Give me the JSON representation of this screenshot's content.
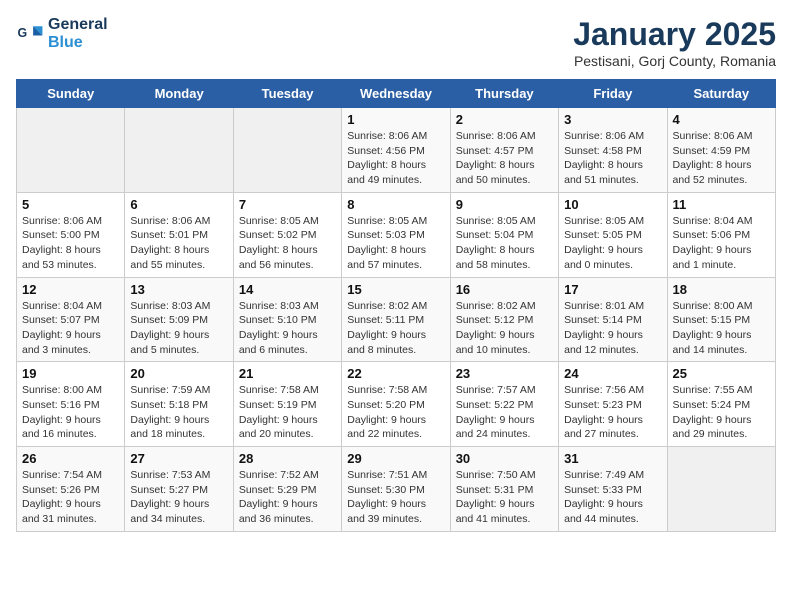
{
  "header": {
    "logo_line1": "General",
    "logo_line2": "Blue",
    "month": "January 2025",
    "location": "Pestisani, Gorj County, Romania"
  },
  "weekdays": [
    "Sunday",
    "Monday",
    "Tuesday",
    "Wednesday",
    "Thursday",
    "Friday",
    "Saturday"
  ],
  "weeks": [
    [
      {
        "day": "",
        "detail": ""
      },
      {
        "day": "",
        "detail": ""
      },
      {
        "day": "",
        "detail": ""
      },
      {
        "day": "1",
        "detail": "Sunrise: 8:06 AM\nSunset: 4:56 PM\nDaylight: 8 hours\nand 49 minutes."
      },
      {
        "day": "2",
        "detail": "Sunrise: 8:06 AM\nSunset: 4:57 PM\nDaylight: 8 hours\nand 50 minutes."
      },
      {
        "day": "3",
        "detail": "Sunrise: 8:06 AM\nSunset: 4:58 PM\nDaylight: 8 hours\nand 51 minutes."
      },
      {
        "day": "4",
        "detail": "Sunrise: 8:06 AM\nSunset: 4:59 PM\nDaylight: 8 hours\nand 52 minutes."
      }
    ],
    [
      {
        "day": "5",
        "detail": "Sunrise: 8:06 AM\nSunset: 5:00 PM\nDaylight: 8 hours\nand 53 minutes."
      },
      {
        "day": "6",
        "detail": "Sunrise: 8:06 AM\nSunset: 5:01 PM\nDaylight: 8 hours\nand 55 minutes."
      },
      {
        "day": "7",
        "detail": "Sunrise: 8:05 AM\nSunset: 5:02 PM\nDaylight: 8 hours\nand 56 minutes."
      },
      {
        "day": "8",
        "detail": "Sunrise: 8:05 AM\nSunset: 5:03 PM\nDaylight: 8 hours\nand 57 minutes."
      },
      {
        "day": "9",
        "detail": "Sunrise: 8:05 AM\nSunset: 5:04 PM\nDaylight: 8 hours\nand 58 minutes."
      },
      {
        "day": "10",
        "detail": "Sunrise: 8:05 AM\nSunset: 5:05 PM\nDaylight: 9 hours\nand 0 minutes."
      },
      {
        "day": "11",
        "detail": "Sunrise: 8:04 AM\nSunset: 5:06 PM\nDaylight: 9 hours\nand 1 minute."
      }
    ],
    [
      {
        "day": "12",
        "detail": "Sunrise: 8:04 AM\nSunset: 5:07 PM\nDaylight: 9 hours\nand 3 minutes."
      },
      {
        "day": "13",
        "detail": "Sunrise: 8:03 AM\nSunset: 5:09 PM\nDaylight: 9 hours\nand 5 minutes."
      },
      {
        "day": "14",
        "detail": "Sunrise: 8:03 AM\nSunset: 5:10 PM\nDaylight: 9 hours\nand 6 minutes."
      },
      {
        "day": "15",
        "detail": "Sunrise: 8:02 AM\nSunset: 5:11 PM\nDaylight: 9 hours\nand 8 minutes."
      },
      {
        "day": "16",
        "detail": "Sunrise: 8:02 AM\nSunset: 5:12 PM\nDaylight: 9 hours\nand 10 minutes."
      },
      {
        "day": "17",
        "detail": "Sunrise: 8:01 AM\nSunset: 5:14 PM\nDaylight: 9 hours\nand 12 minutes."
      },
      {
        "day": "18",
        "detail": "Sunrise: 8:00 AM\nSunset: 5:15 PM\nDaylight: 9 hours\nand 14 minutes."
      }
    ],
    [
      {
        "day": "19",
        "detail": "Sunrise: 8:00 AM\nSunset: 5:16 PM\nDaylight: 9 hours\nand 16 minutes."
      },
      {
        "day": "20",
        "detail": "Sunrise: 7:59 AM\nSunset: 5:18 PM\nDaylight: 9 hours\nand 18 minutes."
      },
      {
        "day": "21",
        "detail": "Sunrise: 7:58 AM\nSunset: 5:19 PM\nDaylight: 9 hours\nand 20 minutes."
      },
      {
        "day": "22",
        "detail": "Sunrise: 7:58 AM\nSunset: 5:20 PM\nDaylight: 9 hours\nand 22 minutes."
      },
      {
        "day": "23",
        "detail": "Sunrise: 7:57 AM\nSunset: 5:22 PM\nDaylight: 9 hours\nand 24 minutes."
      },
      {
        "day": "24",
        "detail": "Sunrise: 7:56 AM\nSunset: 5:23 PM\nDaylight: 9 hours\nand 27 minutes."
      },
      {
        "day": "25",
        "detail": "Sunrise: 7:55 AM\nSunset: 5:24 PM\nDaylight: 9 hours\nand 29 minutes."
      }
    ],
    [
      {
        "day": "26",
        "detail": "Sunrise: 7:54 AM\nSunset: 5:26 PM\nDaylight: 9 hours\nand 31 minutes."
      },
      {
        "day": "27",
        "detail": "Sunrise: 7:53 AM\nSunset: 5:27 PM\nDaylight: 9 hours\nand 34 minutes."
      },
      {
        "day": "28",
        "detail": "Sunrise: 7:52 AM\nSunset: 5:29 PM\nDaylight: 9 hours\nand 36 minutes."
      },
      {
        "day": "29",
        "detail": "Sunrise: 7:51 AM\nSunset: 5:30 PM\nDaylight: 9 hours\nand 39 minutes."
      },
      {
        "day": "30",
        "detail": "Sunrise: 7:50 AM\nSunset: 5:31 PM\nDaylight: 9 hours\nand 41 minutes."
      },
      {
        "day": "31",
        "detail": "Sunrise: 7:49 AM\nSunset: 5:33 PM\nDaylight: 9 hours\nand 44 minutes."
      },
      {
        "day": "",
        "detail": ""
      }
    ]
  ]
}
